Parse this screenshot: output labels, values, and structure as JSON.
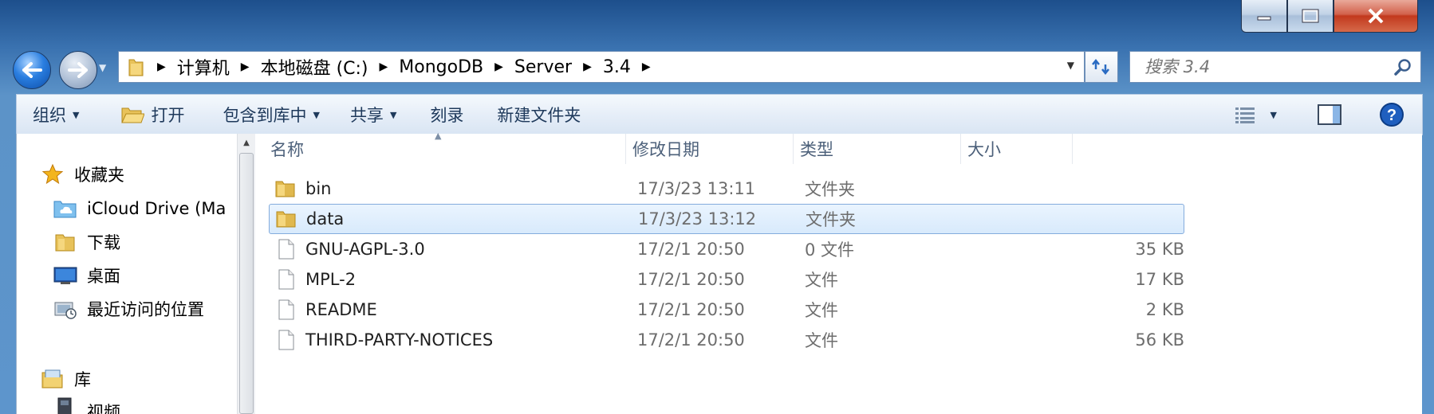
{
  "window": {
    "caption_buttons": [
      "minimize",
      "maximize",
      "close"
    ]
  },
  "address_bar": {
    "crumbs": [
      "计算机",
      "本地磁盘 (C:)",
      "MongoDB",
      "Server",
      "3.4"
    ],
    "search_placeholder": "搜索 3.4"
  },
  "toolbar": {
    "organize": "组织",
    "open": "打开",
    "include_in_library": "包含到库中",
    "share": "共享",
    "burn": "刻录",
    "new_folder": "新建文件夹"
  },
  "nav_pane": {
    "favorites": "收藏夹",
    "items": [
      "iCloud Drive (Ma",
      "下载",
      "桌面",
      "最近访问的位置"
    ],
    "libraries": "库",
    "lib_items": [
      "视频"
    ]
  },
  "columns": {
    "name": "名称",
    "modified": "修改日期",
    "type": "类型",
    "size": "大小"
  },
  "files": [
    {
      "name": "bin",
      "modified": "17/3/23 13:11",
      "type": "文件夹",
      "size": "",
      "icon": "folder-icon"
    },
    {
      "name": "data",
      "modified": "17/3/23 13:12",
      "type": "文件夹",
      "size": "",
      "icon": "folder-icon",
      "selected": true
    },
    {
      "name": "GNU-AGPL-3.0",
      "modified": "17/2/1 20:50",
      "type": "0 文件",
      "size": "35 KB",
      "icon": "file-icon"
    },
    {
      "name": "MPL-2",
      "modified": "17/2/1 20:50",
      "type": "文件",
      "size": "17 KB",
      "icon": "file-icon"
    },
    {
      "name": "README",
      "modified": "17/2/1 20:50",
      "type": "文件",
      "size": "2 KB",
      "icon": "file-icon"
    },
    {
      "name": "THIRD-PARTY-NOTICES",
      "modified": "17/2/1 20:50",
      "type": "文件",
      "size": "56 KB",
      "icon": "file-icon"
    }
  ],
  "colors": {
    "selection_bg": "#d8eafc",
    "selection_border": "#84acdd",
    "toolbar_text": "#1e395b",
    "folder": "#e8c25a"
  }
}
